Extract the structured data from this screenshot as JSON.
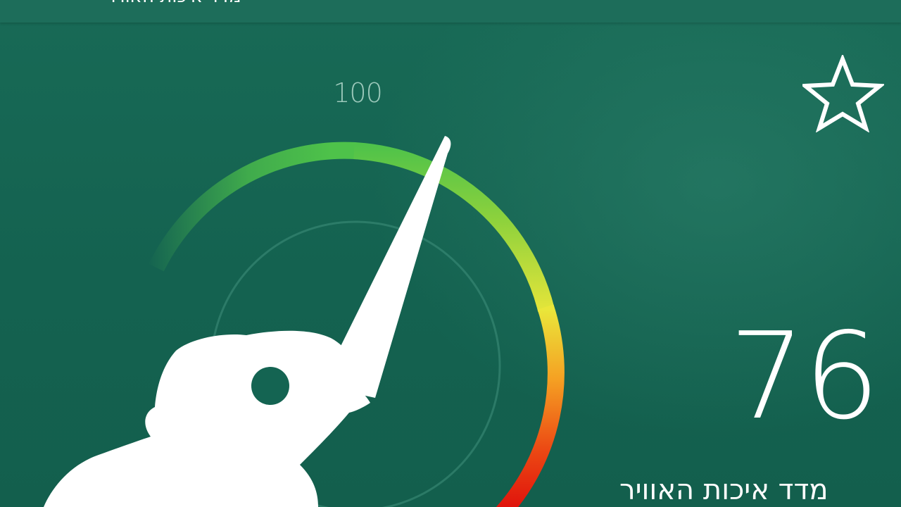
{
  "header": {
    "title": "מדד איכות האוויר"
  },
  "gauge": {
    "max_label": "100",
    "value": 76,
    "max": 100,
    "colors": {
      "good": "#4ec24a",
      "moderate": "#e9e63c",
      "unhealthy": "#f28a1c",
      "hazardous": "#e41a0d"
    },
    "mascot_icon": "kiwi-bird-needle-icon"
  },
  "reading": {
    "value": "76",
    "label": "מדד איכות האוויר"
  },
  "favorite": {
    "icon": "star-outline-icon"
  },
  "theme": {
    "background": "#146451",
    "text": "#ffffff"
  }
}
